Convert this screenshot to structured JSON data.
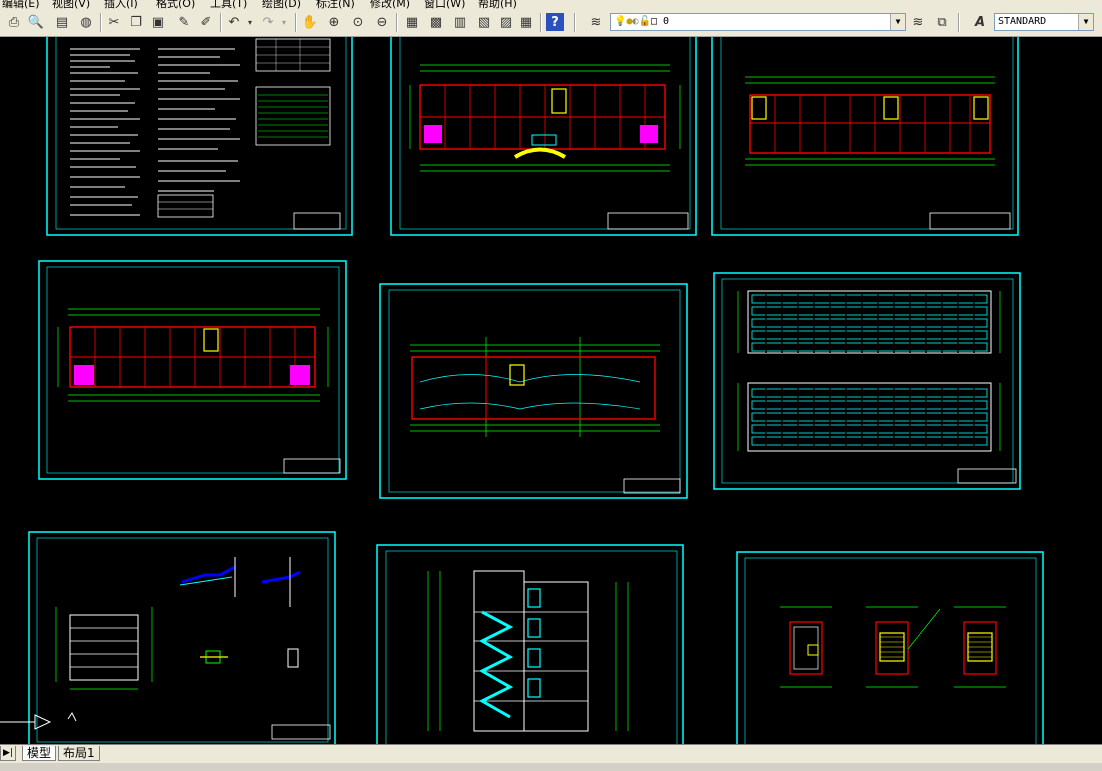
{
  "menubar": {
    "items": [
      "编辑(E)",
      "视图(V)",
      "插入(I)",
      "格式(O)",
      "工具(T)",
      "绘图(D)",
      "标注(N)",
      "修改(M)",
      "窗口(W)",
      "帮助(H)"
    ]
  },
  "toolbar": {
    "layer_name": "0",
    "text_style": "STANDARD"
  },
  "tabs": {
    "model": "模型",
    "layout1": "布局1"
  },
  "colors": {
    "sheet_border": "#00ffff",
    "wall": "#ff0000",
    "dimension": "#00ff00",
    "room": "#ffffff",
    "stair": "#ffff00",
    "accent": "#ff00ff",
    "detail": "#0000ff"
  }
}
